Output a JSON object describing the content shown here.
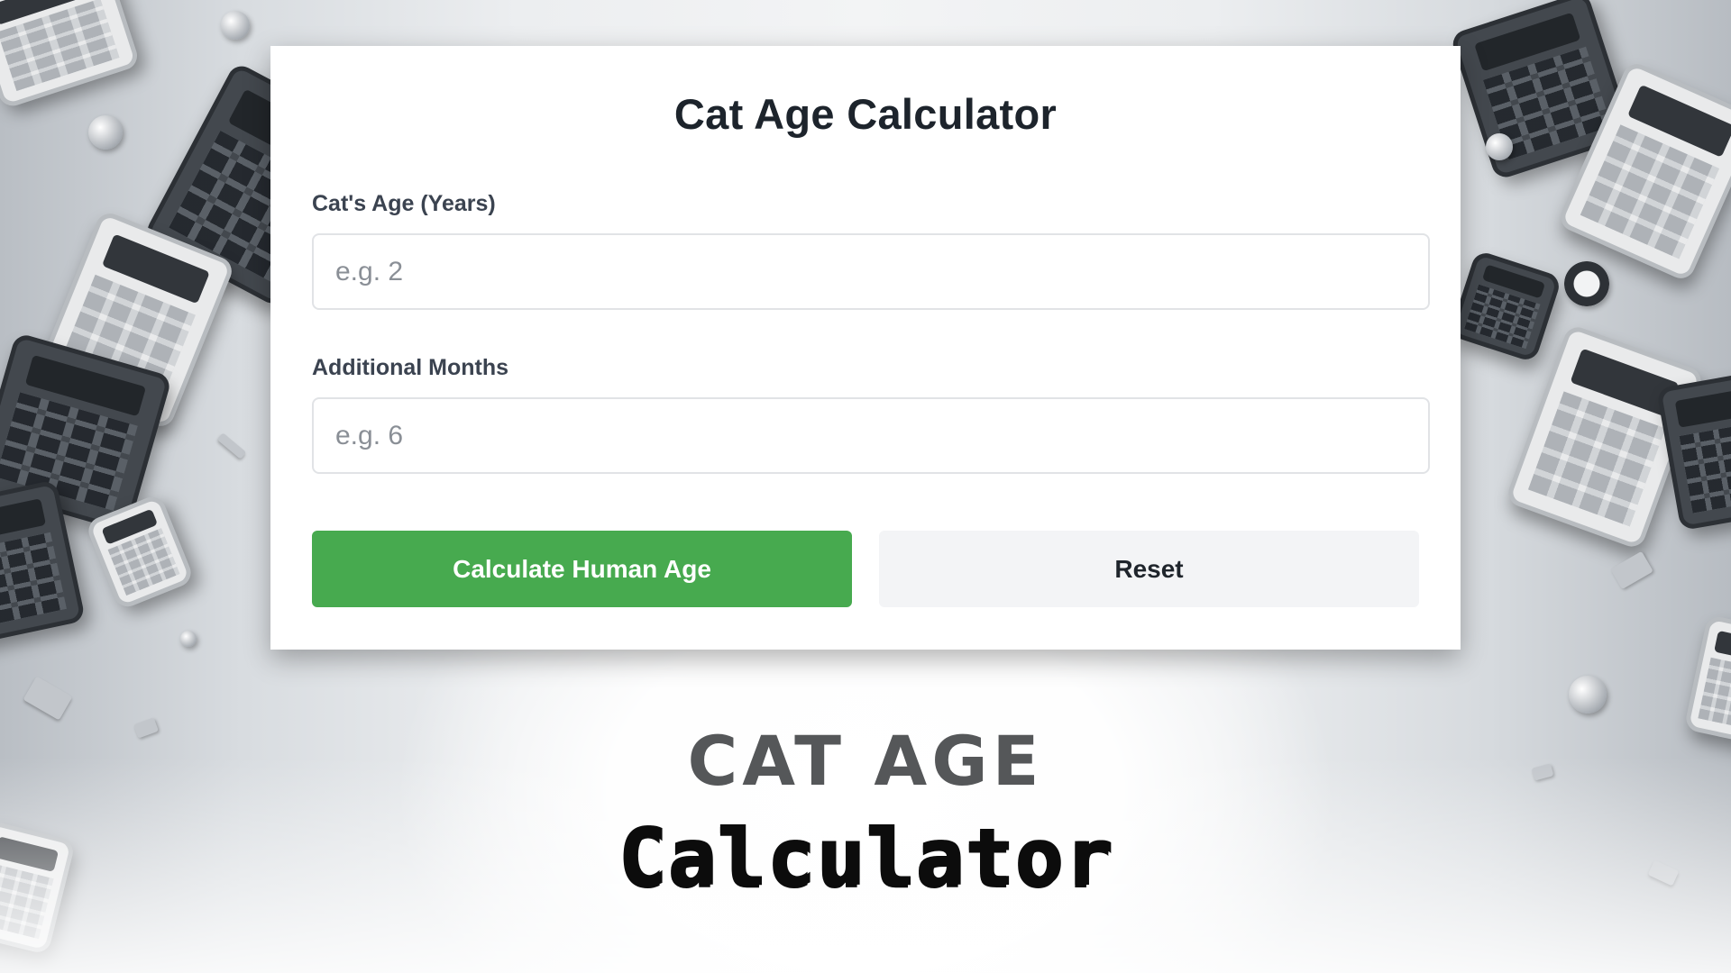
{
  "calculator": {
    "title": "Cat Age Calculator",
    "age_field": {
      "label": "Cat's Age (Years)",
      "placeholder": "e.g. 2",
      "value": ""
    },
    "months_field": {
      "label": "Additional Months",
      "placeholder": "e.g. 6",
      "value": ""
    },
    "calculate_button": "Calculate Human Age",
    "reset_button": "Reset"
  },
  "caption": {
    "line1": "CAT AGE",
    "line2": "Calculator"
  },
  "colors": {
    "primary_button": "#47aa4f",
    "secondary_button": "#f3f4f6",
    "title_text": "#1d242c",
    "caption_line1": "#555759",
    "caption_line2": "#0c0c0c"
  }
}
